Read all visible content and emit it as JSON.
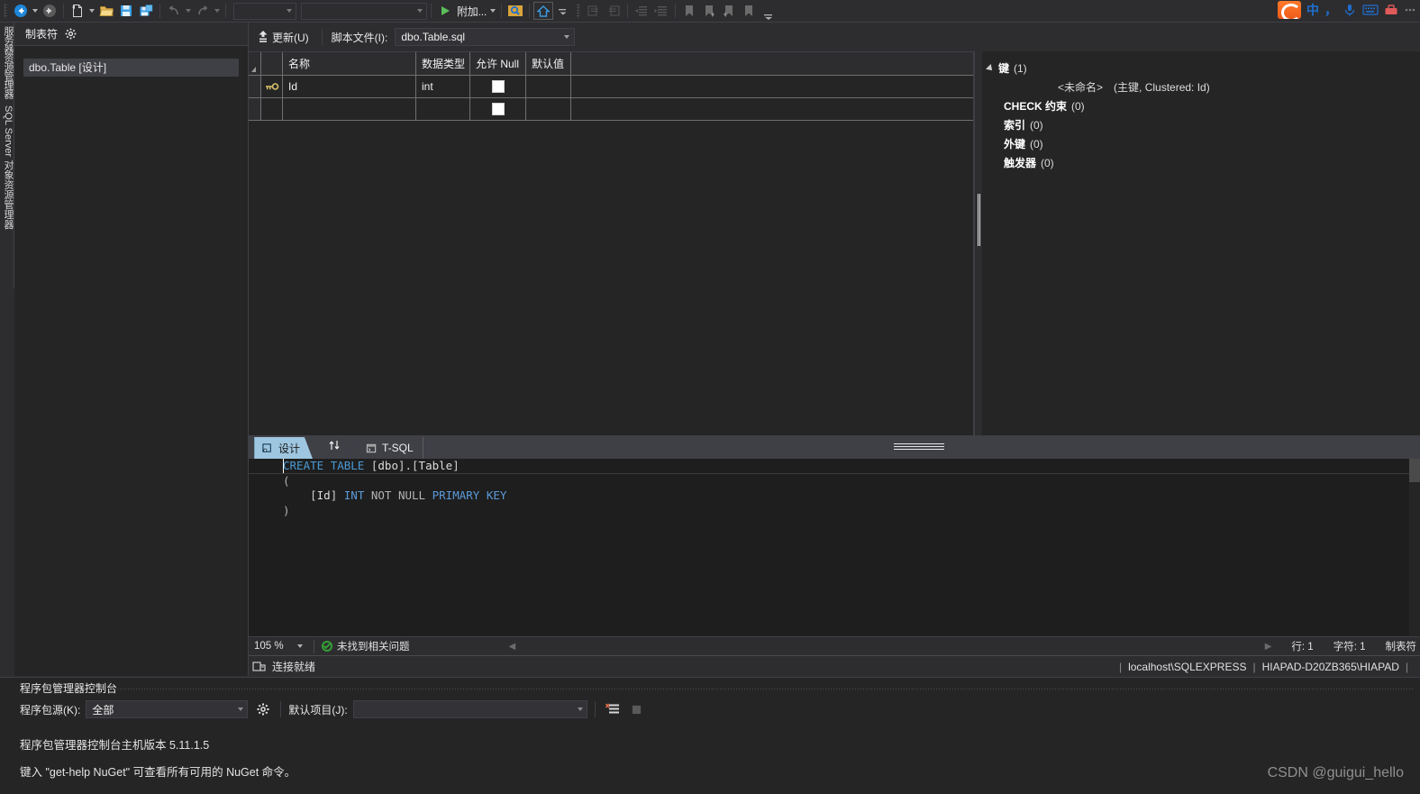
{
  "toolbar": {
    "buttons": [
      {
        "name": "navigate-back-icon",
        "label": ""
      },
      {
        "name": "navigate-forward-icon",
        "label": ""
      },
      {
        "name": "new-file-icon",
        "label": ""
      },
      {
        "name": "open-file-icon",
        "label": ""
      },
      {
        "name": "save-icon",
        "label": ""
      },
      {
        "name": "save-all-icon",
        "label": ""
      },
      {
        "name": "undo-icon",
        "label": ""
      },
      {
        "name": "redo-icon",
        "label": ""
      }
    ],
    "attach_label": "附加...",
    "combo1_value": "",
    "combo2_value": ""
  },
  "ime": {
    "chinese_mode": "中",
    "punctuation": "，"
  },
  "vertical_dock": {
    "tabs": [
      {
        "label": "服务器资源管理器"
      },
      {
        "label": "SQL Server 对象资源管理器"
      }
    ]
  },
  "left_panel": {
    "title": "制表符",
    "gear_icon": "gear-icon",
    "items": [
      {
        "label": "dbo.Table [设计]",
        "selected": true
      }
    ]
  },
  "designer_toolbar": {
    "update_label": "更新(U)",
    "script_label": "脚本文件(I):",
    "script_value": "dbo.Table.sql"
  },
  "grid": {
    "columns": [
      "名称",
      "数据类型",
      "允许 Null",
      "默认值"
    ],
    "rows": [
      {
        "key_icon": true,
        "name": "Id",
        "type": "int",
        "allow_null": false,
        "default": ""
      },
      {
        "key_icon": false,
        "name": "",
        "type": "",
        "allow_null": false,
        "default": ""
      }
    ]
  },
  "keys_panel": {
    "nodes": [
      {
        "label": "键",
        "count": "(1)",
        "level": 0,
        "expanded": true
      },
      {
        "label": "<未命名>",
        "detail": "(主键, Clustered: Id)",
        "level": 2
      },
      {
        "label": "CHECK 约束",
        "count": "(0)",
        "level": 1
      },
      {
        "label": "索引",
        "count": "(0)",
        "level": 1
      },
      {
        "label": "外键",
        "count": "(0)",
        "level": 1
      },
      {
        "label": "触发器",
        "count": "(0)",
        "level": 1
      }
    ]
  },
  "designer_tabs": {
    "design_tab": "设计",
    "tsql_tab": "T-SQL",
    "swap_icon": "swap-arrows-icon"
  },
  "sql_editor": {
    "lines": [
      [
        {
          "t": "CREATE",
          "c": "kw"
        },
        {
          "t": " ",
          "c": "plain"
        },
        {
          "t": "TABLE",
          "c": "kw"
        },
        {
          "t": " [",
          "c": "brk"
        },
        {
          "t": "dbo",
          "c": "plain"
        },
        {
          "t": "].[",
          "c": "brk"
        },
        {
          "t": "Table",
          "c": "plain"
        },
        {
          "t": "]",
          "c": "brk"
        }
      ],
      [
        {
          "t": "(",
          "c": "gray"
        }
      ],
      [
        {
          "t": "    [",
          "c": "brk"
        },
        {
          "t": "Id",
          "c": "plain"
        },
        {
          "t": "] ",
          "c": "brk"
        },
        {
          "t": "INT",
          "c": "kw2"
        },
        {
          "t": " ",
          "c": "plain"
        },
        {
          "t": "NOT",
          "c": "gray"
        },
        {
          "t": " ",
          "c": "plain"
        },
        {
          "t": "NULL",
          "c": "gray"
        },
        {
          "t": " ",
          "c": "plain"
        },
        {
          "t": "PRIMARY",
          "c": "kw2"
        },
        {
          "t": " ",
          "c": "plain"
        },
        {
          "t": "KEY",
          "c": "kw2"
        }
      ],
      [
        {
          "t": ")",
          "c": "gray"
        }
      ]
    ]
  },
  "editor_status": {
    "zoom": "105 %",
    "message": "未找到相关问题",
    "line_label": "行: 1",
    "char_label": "字符: 1",
    "tab_label": "制表符"
  },
  "connection_bar": {
    "status": "连接就绪",
    "server": "localhost\\SQLEXPRESS",
    "machine": "HIAPAD-D20ZB365\\HIAPAD"
  },
  "package_console": {
    "title": "程序包管理器控制台",
    "source_label": "程序包源(K):",
    "source_value": "全部",
    "project_label": "默认项目(J):",
    "project_value": "",
    "gear_icon": "gear-icon",
    "clear_icon": "clear-console-icon",
    "stop_icon": "stop-icon",
    "output_lines": [
      "程序包管理器控制台主机版本 5.11.1.5",
      "键入 \"get-help NuGet\" 可查看所有可用的 NuGet 命令。"
    ]
  },
  "watermark": {
    "text": "CSDN @guigui_hello"
  },
  "colors": {
    "background": "#2d2d30",
    "panel": "#252526",
    "editor_bg": "#1e1e1e",
    "accent_tab": "#9ec6e0",
    "keyword": "#4a9ad4",
    "border": "#3f3f46",
    "selection": "#3f3f46"
  }
}
